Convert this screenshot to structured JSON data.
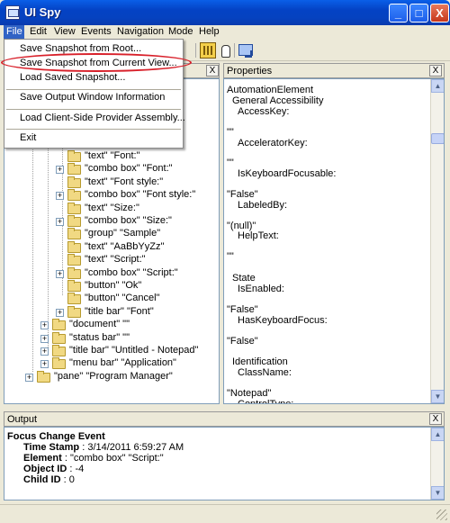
{
  "window": {
    "title": "UI Spy",
    "minimize_glyph": "_",
    "maximize_glyph": "□",
    "close_glyph": "X"
  },
  "menubar": {
    "file": "File",
    "edit": "Edit",
    "view": "View",
    "events": "Events",
    "navigation": "Navigation",
    "mode": "Mode",
    "help": "Help"
  },
  "file_menu": {
    "items": [
      "Save Snapshot from Root...",
      "Save Snapshot from Current View...",
      "Load Saved Snapshot...",
      "Save Output Window Information",
      "Load Client-Side Provider Assembly...",
      "Exit"
    ]
  },
  "tree": {
    "close_glyph": "X",
    "rows": [
      {
        "label": "\"text\" \"Font:\"",
        "expandable": false
      },
      {
        "label": "\"combo box\" \"Font:\"",
        "expandable": true
      },
      {
        "label": "\"text\" \"Font style:\"",
        "expandable": false
      },
      {
        "label": "\"combo box\" \"Font style:\"",
        "expandable": true
      },
      {
        "label": "\"text\" \"Size:\"",
        "expandable": false
      },
      {
        "label": "\"combo box\" \"Size:\"",
        "expandable": true
      },
      {
        "label": "\"group\" \"Sample\"",
        "expandable": false
      },
      {
        "label": "\"text\" \"AaBbYyZz\"",
        "expandable": false
      },
      {
        "label": "\"text\" \"Script:\"",
        "expandable": false
      },
      {
        "label": "\"combo box\" \"Script:\"",
        "expandable": true
      },
      {
        "label": "\"button\" \"Ok\"",
        "expandable": false
      },
      {
        "label": "\"button\" \"Cancel\"",
        "expandable": false
      },
      {
        "label": "\"title bar\" \"Font\"",
        "expandable": true
      },
      {
        "label": "\"document\" \"\"",
        "expandable": true
      },
      {
        "label": "\"status bar\" \"\"",
        "expandable": true
      },
      {
        "label": "\"title bar\" \"Untitled - Notepad\"",
        "expandable": true
      },
      {
        "label": "\"menu bar\" \"Application\"",
        "expandable": true
      },
      {
        "label": "\"pane\" \"Program Manager\"",
        "expandable": true
      }
    ],
    "expand_glyph": "+"
  },
  "properties": {
    "title": "Properties",
    "close_glyph": "X",
    "lines": [
      "AutomationElement",
      "General Accessibility",
      "AccessKey:",
      "\"\"",
      "AcceleratorKey:",
      "\"\"",
      "IsKeyboardFocusable:",
      "\"False\"",
      "LabeledBy:",
      "\"(null)\"",
      "HelpText:",
      "\"\"",
      "State",
      "IsEnabled:",
      "\"False\"",
      "HasKeyboardFocus:",
      "\"False\"",
      "Identification",
      "ClassName:",
      "\"Notepad\"",
      "ControlType:"
    ]
  },
  "output": {
    "title": "Output",
    "close_glyph": "X",
    "event_title": "Focus Change Event",
    "timestamp_label": "Time Stamp",
    "timestamp_value": " : 3/14/2011 6:59:27 AM",
    "element_label": "Element",
    "element_value": " : \"combo box\" \"Script:\"",
    "objectid_label": "Object ID",
    "objectid_value": " : -4",
    "childid_label": "Child ID",
    "childid_value": " : 0"
  },
  "scroll": {
    "up_glyph": "▲",
    "down_glyph": "▼"
  },
  "colors": {
    "titlebar": "#0a5fe8",
    "menu_selected": "#3163c5",
    "annotation": "#d8202a"
  }
}
